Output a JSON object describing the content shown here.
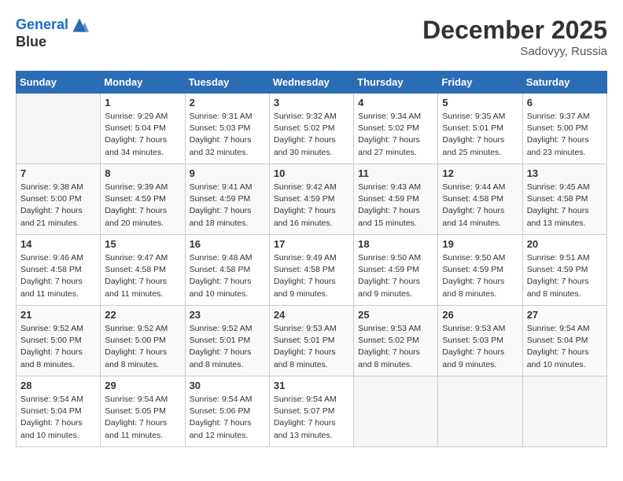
{
  "header": {
    "logo_line1": "General",
    "logo_line2": "Blue",
    "month": "December 2025",
    "location": "Sadovyy, Russia"
  },
  "weekdays": [
    "Sunday",
    "Monday",
    "Tuesday",
    "Wednesday",
    "Thursday",
    "Friday",
    "Saturday"
  ],
  "weeks": [
    [
      {
        "day": "",
        "sunrise": "",
        "sunset": "",
        "daylight": ""
      },
      {
        "day": "1",
        "sunrise": "Sunrise: 9:29 AM",
        "sunset": "Sunset: 5:04 PM",
        "daylight": "Daylight: 7 hours and 34 minutes."
      },
      {
        "day": "2",
        "sunrise": "Sunrise: 9:31 AM",
        "sunset": "Sunset: 5:03 PM",
        "daylight": "Daylight: 7 hours and 32 minutes."
      },
      {
        "day": "3",
        "sunrise": "Sunrise: 9:32 AM",
        "sunset": "Sunset: 5:02 PM",
        "daylight": "Daylight: 7 hours and 30 minutes."
      },
      {
        "day": "4",
        "sunrise": "Sunrise: 9:34 AM",
        "sunset": "Sunset: 5:02 PM",
        "daylight": "Daylight: 7 hours and 27 minutes."
      },
      {
        "day": "5",
        "sunrise": "Sunrise: 9:35 AM",
        "sunset": "Sunset: 5:01 PM",
        "daylight": "Daylight: 7 hours and 25 minutes."
      },
      {
        "day": "6",
        "sunrise": "Sunrise: 9:37 AM",
        "sunset": "Sunset: 5:00 PM",
        "daylight": "Daylight: 7 hours and 23 minutes."
      }
    ],
    [
      {
        "day": "7",
        "sunrise": "Sunrise: 9:38 AM",
        "sunset": "Sunset: 5:00 PM",
        "daylight": "Daylight: 7 hours and 21 minutes."
      },
      {
        "day": "8",
        "sunrise": "Sunrise: 9:39 AM",
        "sunset": "Sunset: 4:59 PM",
        "daylight": "Daylight: 7 hours and 20 minutes."
      },
      {
        "day": "9",
        "sunrise": "Sunrise: 9:41 AM",
        "sunset": "Sunset: 4:59 PM",
        "daylight": "Daylight: 7 hours and 18 minutes."
      },
      {
        "day": "10",
        "sunrise": "Sunrise: 9:42 AM",
        "sunset": "Sunset: 4:59 PM",
        "daylight": "Daylight: 7 hours and 16 minutes."
      },
      {
        "day": "11",
        "sunrise": "Sunrise: 9:43 AM",
        "sunset": "Sunset: 4:59 PM",
        "daylight": "Daylight: 7 hours and 15 minutes."
      },
      {
        "day": "12",
        "sunrise": "Sunrise: 9:44 AM",
        "sunset": "Sunset: 4:58 PM",
        "daylight": "Daylight: 7 hours and 14 minutes."
      },
      {
        "day": "13",
        "sunrise": "Sunrise: 9:45 AM",
        "sunset": "Sunset: 4:58 PM",
        "daylight": "Daylight: 7 hours and 13 minutes."
      }
    ],
    [
      {
        "day": "14",
        "sunrise": "Sunrise: 9:46 AM",
        "sunset": "Sunset: 4:58 PM",
        "daylight": "Daylight: 7 hours and 11 minutes."
      },
      {
        "day": "15",
        "sunrise": "Sunrise: 9:47 AM",
        "sunset": "Sunset: 4:58 PM",
        "daylight": "Daylight: 7 hours and 11 minutes."
      },
      {
        "day": "16",
        "sunrise": "Sunrise: 9:48 AM",
        "sunset": "Sunset: 4:58 PM",
        "daylight": "Daylight: 7 hours and 10 minutes."
      },
      {
        "day": "17",
        "sunrise": "Sunrise: 9:49 AM",
        "sunset": "Sunset: 4:58 PM",
        "daylight": "Daylight: 7 hours and 9 minutes."
      },
      {
        "day": "18",
        "sunrise": "Sunrise: 9:50 AM",
        "sunset": "Sunset: 4:59 PM",
        "daylight": "Daylight: 7 hours and 9 minutes."
      },
      {
        "day": "19",
        "sunrise": "Sunrise: 9:50 AM",
        "sunset": "Sunset: 4:59 PM",
        "daylight": "Daylight: 7 hours and 8 minutes."
      },
      {
        "day": "20",
        "sunrise": "Sunrise: 9:51 AM",
        "sunset": "Sunset: 4:59 PM",
        "daylight": "Daylight: 7 hours and 8 minutes."
      }
    ],
    [
      {
        "day": "21",
        "sunrise": "Sunrise: 9:52 AM",
        "sunset": "Sunset: 5:00 PM",
        "daylight": "Daylight: 7 hours and 8 minutes."
      },
      {
        "day": "22",
        "sunrise": "Sunrise: 9:52 AM",
        "sunset": "Sunset: 5:00 PM",
        "daylight": "Daylight: 7 hours and 8 minutes."
      },
      {
        "day": "23",
        "sunrise": "Sunrise: 9:52 AM",
        "sunset": "Sunset: 5:01 PM",
        "daylight": "Daylight: 7 hours and 8 minutes."
      },
      {
        "day": "24",
        "sunrise": "Sunrise: 9:53 AM",
        "sunset": "Sunset: 5:01 PM",
        "daylight": "Daylight: 7 hours and 8 minutes."
      },
      {
        "day": "25",
        "sunrise": "Sunrise: 9:53 AM",
        "sunset": "Sunset: 5:02 PM",
        "daylight": "Daylight: 7 hours and 8 minutes."
      },
      {
        "day": "26",
        "sunrise": "Sunrise: 9:53 AM",
        "sunset": "Sunset: 5:03 PM",
        "daylight": "Daylight: 7 hours and 9 minutes."
      },
      {
        "day": "27",
        "sunrise": "Sunrise: 9:54 AM",
        "sunset": "Sunset: 5:04 PM",
        "daylight": "Daylight: 7 hours and 10 minutes."
      }
    ],
    [
      {
        "day": "28",
        "sunrise": "Sunrise: 9:54 AM",
        "sunset": "Sunset: 5:04 PM",
        "daylight": "Daylight: 7 hours and 10 minutes."
      },
      {
        "day": "29",
        "sunrise": "Sunrise: 9:54 AM",
        "sunset": "Sunset: 5:05 PM",
        "daylight": "Daylight: 7 hours and 11 minutes."
      },
      {
        "day": "30",
        "sunrise": "Sunrise: 9:54 AM",
        "sunset": "Sunset: 5:06 PM",
        "daylight": "Daylight: 7 hours and 12 minutes."
      },
      {
        "day": "31",
        "sunrise": "Sunrise: 9:54 AM",
        "sunset": "Sunset: 5:07 PM",
        "daylight": "Daylight: 7 hours and 13 minutes."
      },
      {
        "day": "",
        "sunrise": "",
        "sunset": "",
        "daylight": ""
      },
      {
        "day": "",
        "sunrise": "",
        "sunset": "",
        "daylight": ""
      },
      {
        "day": "",
        "sunrise": "",
        "sunset": "",
        "daylight": ""
      }
    ]
  ]
}
